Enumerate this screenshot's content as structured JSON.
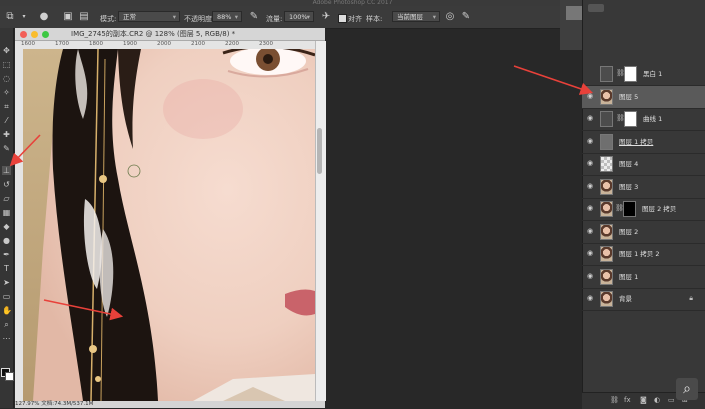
{
  "app": {
    "title": "Adobe Photoshop CC 2017"
  },
  "options_bar": {
    "mode_label": "模式:",
    "mode_value": "正常",
    "opacity_label": "不透明度:",
    "opacity_value": "88%",
    "flow_label": "流量:",
    "flow_value": "100%",
    "aligned_label": "对齐",
    "sample_label": "样本:",
    "sample_value": "当前图层"
  },
  "document": {
    "title": "IMG_2745的副本.CR2 @ 128% (图层 5, RGB/8) *",
    "ruler_ticks": [
      "1600",
      "1700",
      "1800",
      "1900",
      "2000",
      "2100",
      "2200",
      "2300"
    ],
    "status": "127.97%        文档:74.3M/537.1M"
  },
  "layers": [
    {
      "name": "黑白 1",
      "thumb": "white",
      "adjust": true,
      "visible": false
    },
    {
      "name": "图层 5",
      "thumb": "face",
      "selected": true,
      "visible": true
    },
    {
      "name": "曲线 1",
      "thumb": "white",
      "adjust": true,
      "visible": true
    },
    {
      "name": "图层 1 拷贝",
      "thumb": "gray",
      "visible": true,
      "underline": true
    },
    {
      "name": "图层 4",
      "thumb": "trans",
      "visible": true
    },
    {
      "name": "图层 3",
      "thumb": "face",
      "visible": true
    },
    {
      "name": "图层 2 拷贝",
      "thumb": "face",
      "mask": "black",
      "visible": true
    },
    {
      "name": "图层 2",
      "thumb": "face",
      "visible": true
    },
    {
      "name": "图层 1 拷贝 2",
      "thumb": "face",
      "visible": true
    },
    {
      "name": "图层 1",
      "thumb": "face",
      "visible": true
    },
    {
      "name": "背景",
      "thumb": "face",
      "visible": true,
      "locked": true
    }
  ],
  "icons": {
    "eye": "eye-icon",
    "lock": "lock-icon",
    "link": "chain-link-icon",
    "search": "magnifier-icon"
  },
  "colors": {
    "annotation_arrow": "#e8413a",
    "selected_layer": "#5a5a5a"
  }
}
